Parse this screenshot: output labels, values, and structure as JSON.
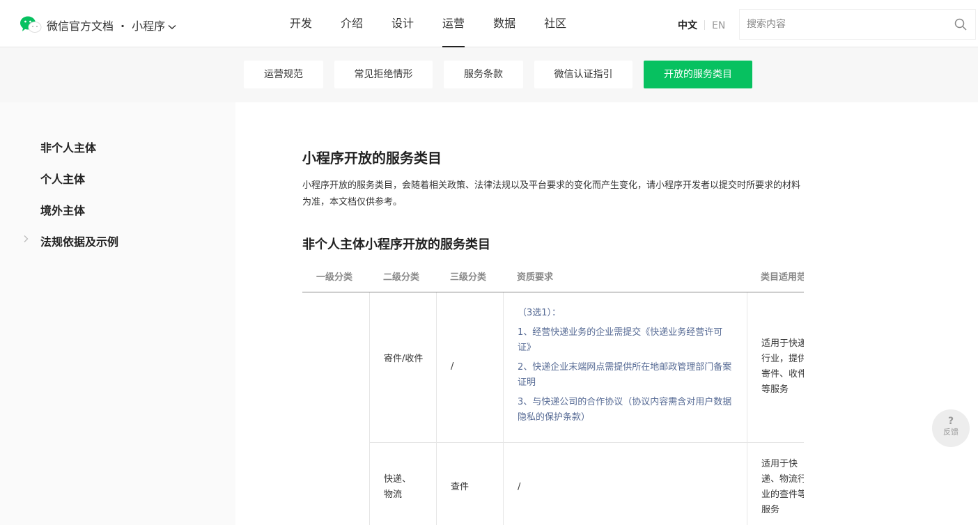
{
  "header": {
    "brand": "微信官方文档",
    "product": "小程序",
    "nav": [
      "开发",
      "介绍",
      "设计",
      "运营",
      "数据",
      "社区"
    ],
    "active_nav": "运营",
    "lang_zh": "中文",
    "lang_en": "EN",
    "search_placeholder": "搜索内容"
  },
  "subnav": {
    "items": [
      "运营规范",
      "常见拒绝情形",
      "服务条款",
      "微信认证指引",
      "开放的服务类目"
    ],
    "active": "开放的服务类目"
  },
  "sidebar": {
    "items": [
      "非个人主体",
      "个人主体",
      "境外主体",
      "法规依据及示例"
    ]
  },
  "content": {
    "title": "小程序开放的服务类目",
    "intro": "小程序开放的服务类目，会随着相关政策、法律法规以及平台要求的变化而产生变化，请小程序开发者以提交时所要求的材料为准，本文档仅供参考。",
    "section_title": "非个人主体小程序开放的服务类目",
    "table": {
      "headers": [
        "一级分类",
        "二级分类",
        "三级分类",
        "资质要求",
        "类目适用范"
      ],
      "rows": [
        {
          "level2": "寄件/收件",
          "level3": "/",
          "qualification": [
            "（3选1）：",
            "1、经营快递业务的企业需提交《快递业务经营许可证》",
            "2、快递企业末端网点需提供所在地邮政管理部门备案证明",
            "3、与快递公司的合作协议（协议内容需含对用户数据隐私的保护条款）"
          ],
          "scope": "适用于快递行业，提供寄件、收件等服务"
        },
        {
          "level2": "快递、物流",
          "level3": "查件",
          "qualification": [
            "/"
          ],
          "scope": "适用于快递、物流行业的查件等服务"
        }
      ]
    }
  },
  "feedback": {
    "icon": "?",
    "label": "反馈"
  },
  "colors": {
    "accent": "#07c160",
    "link": "#576b95"
  }
}
